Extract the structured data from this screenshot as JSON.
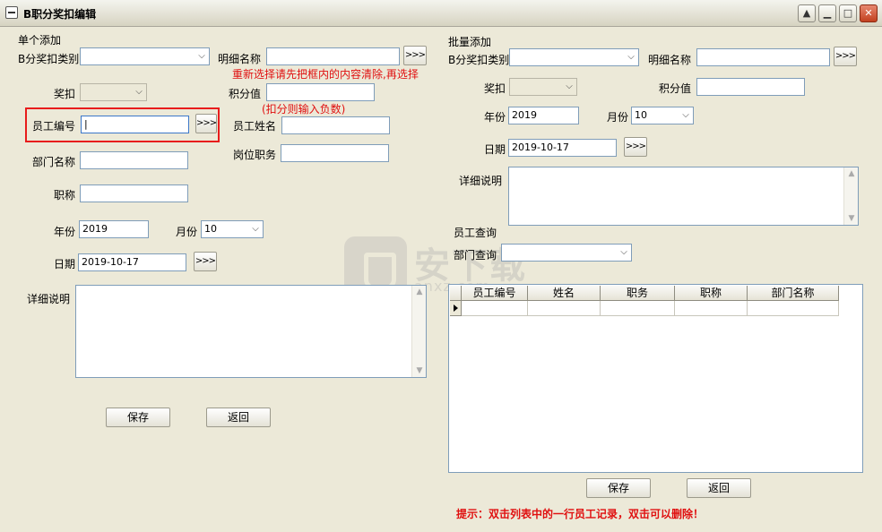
{
  "window": {
    "title": "B职分奖扣编辑"
  },
  "left": {
    "section_title": "单个添加",
    "category_label": "B分奖扣类别",
    "category_value": "",
    "detail_name_label": "明细名称",
    "detail_name_value": "",
    "more_btn": ">>>",
    "reselect_hint": "重新选择请先把框内的内容清除,再选择",
    "reward_label": "奖扣",
    "reward_value": "",
    "score_label": "积分值",
    "score_value": "",
    "score_hint": "(扣分则输入负数)",
    "emp_no_label": "员工编号",
    "emp_no_value": "|",
    "emp_name_label": "员工姓名",
    "emp_name_value": "",
    "position_label": "岗位职务",
    "position_value": "",
    "dept_label": "部门名称",
    "dept_value": "",
    "title_label": "职称",
    "title_value": "",
    "year_label": "年份",
    "year_value": "2019",
    "month_label": "月份",
    "month_value": "10",
    "date_label": "日期",
    "date_value": "2019-10-17",
    "desc_label": "详细说明",
    "save_btn": "保存",
    "back_btn": "返回"
  },
  "right": {
    "section_title": "批量添加",
    "category_label": "B分奖扣类别",
    "category_value": "",
    "detail_name_label": "明细名称",
    "detail_name_value": "",
    "more_btn": ">>>",
    "reward_label": "奖扣",
    "reward_value": "",
    "score_label": "积分值",
    "score_value": "",
    "year_label": "年份",
    "year_value": "2019",
    "month_label": "月份",
    "month_value": "10",
    "date_label": "日期",
    "date_value": "2019-10-17",
    "desc_label": "详细说明",
    "emp_query_title": "员工查询",
    "dept_query_label": "部门查询",
    "dept_query_value": "",
    "grid_columns": [
      "员工编号",
      "姓名",
      "职务",
      "职称",
      "部门名称"
    ],
    "save_btn": "保存",
    "back_btn": "返回",
    "tip": "提示：双击列表中的一行员工记录，双击可以删除！"
  },
  "watermark": {
    "text": "安下载",
    "url": "anxz.com"
  }
}
